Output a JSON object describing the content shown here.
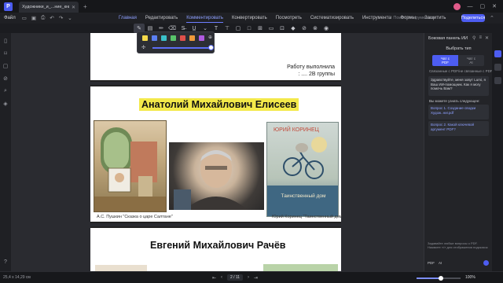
{
  "titlebar": {
    "app_logo": "P",
    "doc_tab_title": "Художники_и_...ние_книг.pdf *",
    "new_tab": "+"
  },
  "menubar": {
    "file_label": "Файл",
    "tabs": [
      {
        "label": "Главная",
        "state": "highlight"
      },
      {
        "label": "Редактировать",
        "state": "normal"
      },
      {
        "label": "Комментировать",
        "state": "active"
      },
      {
        "label": "Конвертировать",
        "state": "normal"
      },
      {
        "label": "Посмотреть",
        "state": "normal"
      },
      {
        "label": "Систематизировать",
        "state": "normal"
      },
      {
        "label": "Инструменты",
        "state": "normal"
      },
      {
        "label": "Формы",
        "state": "normal"
      },
      {
        "label": "Защитить",
        "state": "normal"
      }
    ],
    "tool_search_label": "Поиск инструментов",
    "share_label": "Поделиться"
  },
  "color_popup": {
    "swatches": [
      "#f5d94a",
      "#5b7ff0",
      "#3ac0c9",
      "#58c46a",
      "#e0504a",
      "#f09a3a",
      "#b05ae0"
    ],
    "opacity_percent": 100
  },
  "page1": {
    "line1": "Работу выполнила",
    "line2": ": .... 2В группы"
  },
  "page2": {
    "author_name": "Анатолий Михайлович Елисеев",
    "cover_title": "ЮРИЙ КОРИНЕЦ",
    "cover_bottom": "Таинственный дом",
    "caption_left": "А.С. Пушкин \"Сказка о царе Салтане\"",
    "caption_right": "Юрий Коринец \"Таинственный дом\""
  },
  "page3": {
    "author_name": "Евгений Михайлович Рачёв"
  },
  "right_panel": {
    "header": "Боковая панель ИИ",
    "choose_label": "Выбрать тип",
    "option_on_line1": "Чат с",
    "option_on_line2": "PDF",
    "option_off_line1": "Чат с",
    "option_off_line2": "AI",
    "linked_text": "Связанные с PDF/не связанные с PDF",
    "greeting": "Здравствуйте, меня зовут Lumi, я Ваш ИИ-помощник. Как я могу помочь Вам?",
    "suggest_title": "Вы можете узнать следующее:",
    "suggestions": [
      "Вопрос 1. Создание сводки Худож..ниг.pdf",
      "Вопрос 2. Какой ключевой аргумент PDF?"
    ],
    "hint": "Задавайте любые вопросы о PDF. Нажмите «/» для отображения подсказок",
    "bottom_pdf": "PDF",
    "bottom_ai": "AI"
  },
  "statusbar": {
    "size": "25,4 x 14,29 см",
    "page_label": "2 / 11",
    "zoom_label": "100%",
    "zoom_fraction": 0.55
  }
}
